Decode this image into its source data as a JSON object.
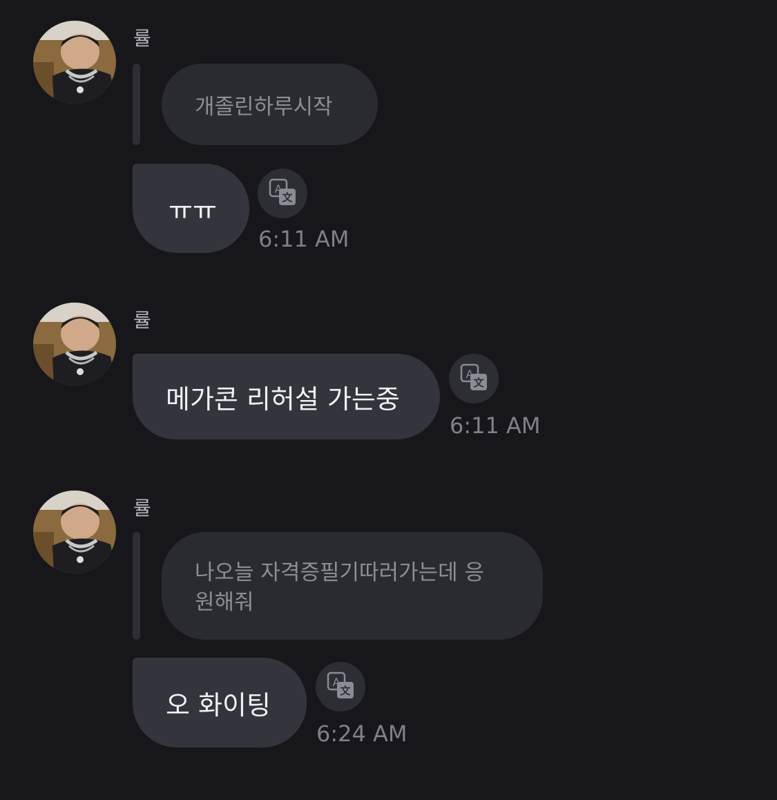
{
  "messages": [
    {
      "sender": "률",
      "quoted": "개졸린하루시작",
      "text": "ㅠㅠ",
      "time": "6:11 AM"
    },
    {
      "sender": "률",
      "text": "메가콘 리허설 가는중",
      "time": "6:11 AM"
    },
    {
      "sender": "률",
      "quoted_line1": "나오늘 자격증필기따러가는데 응",
      "quoted_line2": "원해줘",
      "text": "오 화이팅",
      "time": "6:24 AM"
    }
  ],
  "icons": {
    "translate": "translate-icon",
    "avatar": "avatar-photo"
  },
  "colors": {
    "background": "#17171b",
    "bubble": "#34353c",
    "quote_bubble": "#2a2b31",
    "timestamp": "#7f8088"
  }
}
